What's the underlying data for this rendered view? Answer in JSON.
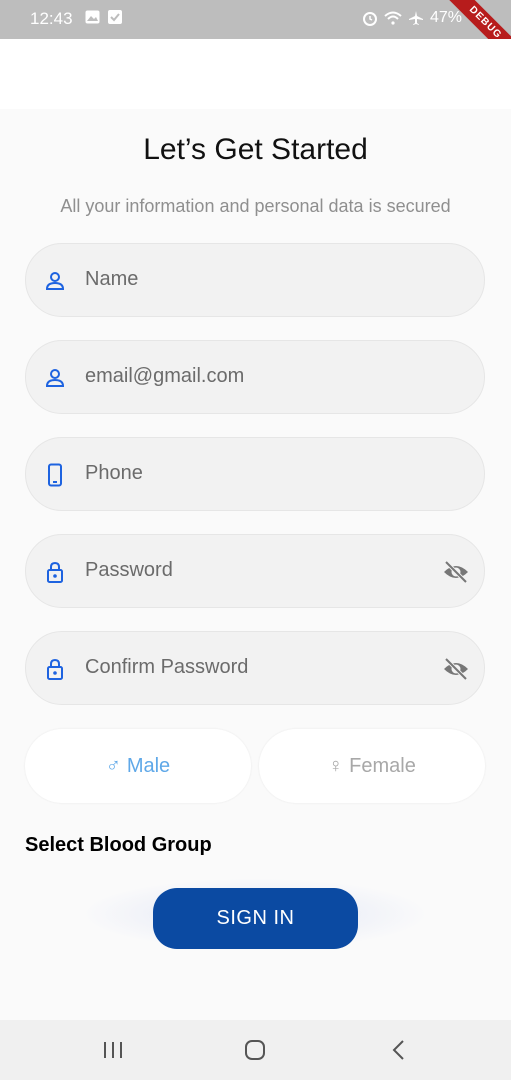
{
  "status_bar": {
    "time": "12:43",
    "battery": "47%",
    "debug_label": "DEBUG"
  },
  "page": {
    "title": "Let’s Get Started",
    "subtitle": "All your information and personal data is secured"
  },
  "fields": {
    "name": "Name",
    "email": "email@gmail.com",
    "phone": "Phone",
    "password": "Password",
    "confirm_password": "Confirm Password"
  },
  "gender": {
    "male_label": "Male",
    "female_label": "Female",
    "male_icon": "♂",
    "female_icon": "♀"
  },
  "blood_group_label": "Select Blood Group",
  "sign_in_label": "SIGN IN",
  "colors": {
    "accent": "#1e63e0",
    "primary_button": "#0b4aa2",
    "male_selected": "#5fa8e8",
    "female_unselected": "#a8a8a8"
  }
}
